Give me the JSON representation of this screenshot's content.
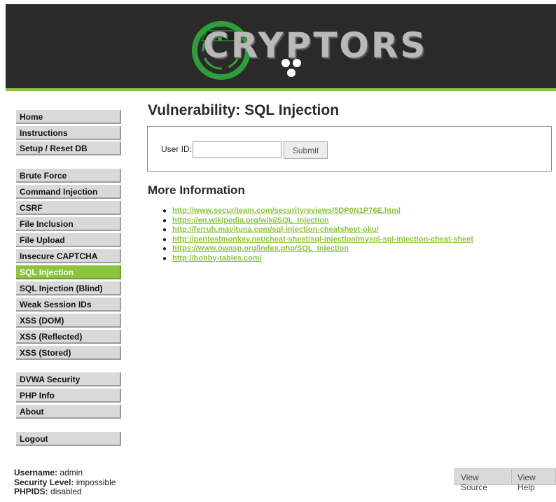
{
  "header": {
    "logo_text": "CRYPTORS",
    "colors": {
      "background": "#2a2a2a",
      "accent": "#8cc43f",
      "logo_text": "#b9b9b9"
    }
  },
  "menu": {
    "group1": [
      "Home",
      "Instructions",
      "Setup / Reset DB"
    ],
    "group2": [
      "Brute Force",
      "Command Injection",
      "CSRF",
      "File Inclusion",
      "File Upload",
      "Insecure CAPTCHA",
      "SQL Injection",
      "SQL Injection (Blind)",
      "Weak Session IDs",
      "XSS (DOM)",
      "XSS (Reflected)",
      "XSS (Stored)"
    ],
    "group3": [
      "DVWA Security",
      "PHP Info",
      "About"
    ],
    "group4": [
      "Logout"
    ],
    "active": "SQL Injection"
  },
  "main": {
    "title": "Vulnerability: SQL Injection",
    "form": {
      "label": "User ID:",
      "input_value": "",
      "submit_label": "Submit"
    },
    "more_info_heading": "More Information",
    "links": [
      "http://www.securiteam.com/securityreviews/5DP0N1P76E.html",
      "https://en.wikipedia.org/wiki/SQL_injection",
      "http://ferruh.mavituna.com/sql-injection-cheatsheet-oku/",
      "http://pentestmonkey.net/cheat-sheet/sql-injection/mysql-sql-injection-cheat-sheet",
      "https://www.owasp.org/index.php/SQL_Injection",
      "http://bobby-tables.com/"
    ]
  },
  "footer": {
    "username_label": "Username:",
    "username": "admin",
    "security_label": "Security Level:",
    "security": "impossible",
    "phpids_label": "PHPIDS:",
    "phpids": "disabled",
    "view_source": "View Source",
    "view_help": "View Help"
  }
}
